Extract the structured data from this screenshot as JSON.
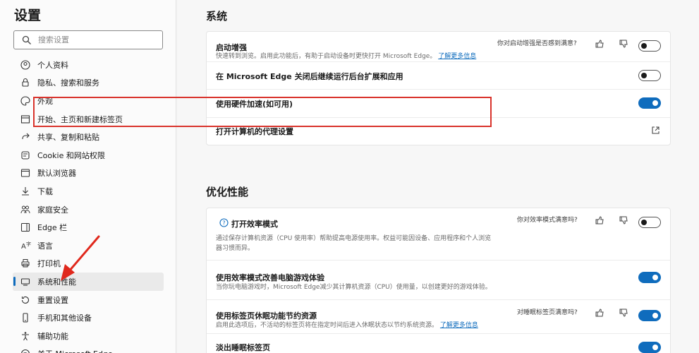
{
  "sidebar": {
    "title": "设置",
    "search_placeholder": "搜索设置",
    "items": [
      {
        "label": "个人资料",
        "icon": "profile-icon"
      },
      {
        "label": "隐私、搜索和服务",
        "icon": "lock-icon"
      },
      {
        "label": "外观",
        "icon": "palette-icon"
      },
      {
        "label": "开始、主页和新建标签页",
        "icon": "home-tab-icon"
      },
      {
        "label": "共享、复制和粘贴",
        "icon": "share-icon"
      },
      {
        "label": "Cookie 和网站权限",
        "icon": "cookie-icon"
      },
      {
        "label": "默认浏览器",
        "icon": "browser-icon"
      },
      {
        "label": "下载",
        "icon": "download-icon"
      },
      {
        "label": "家庭安全",
        "icon": "family-icon"
      },
      {
        "label": "Edge 栏",
        "icon": "edge-bar-icon"
      },
      {
        "label": "语言",
        "icon": "language-icon"
      },
      {
        "label": "打印机",
        "icon": "printer-icon"
      },
      {
        "label": "系统和性能",
        "icon": "system-icon",
        "active": true
      },
      {
        "label": "重置设置",
        "icon": "reset-icon"
      },
      {
        "label": "手机和其他设备",
        "icon": "phone-icon"
      },
      {
        "label": "辅助功能",
        "icon": "accessibility-icon"
      },
      {
        "label": "关于 Microsoft Edge",
        "icon": "edge-icon"
      }
    ]
  },
  "system": {
    "title": "系统",
    "startup_boost": {
      "label": "启动增强",
      "desc": "快速转到浏览。启用此功能后，有助于启动设备时更快打开 Microsoft Edge。",
      "link": "了解更多信息",
      "question": "你对启动增强是否感到满意?",
      "enabled": false
    },
    "background": {
      "label": "在 Microsoft Edge 关闭后继续运行后台扩展和应用",
      "enabled": false
    },
    "hardware": {
      "label": "使用硬件加速(如可用)",
      "enabled": true
    },
    "proxy": {
      "label": "打开计算机的代理设置"
    }
  },
  "performance": {
    "title": "优化性能",
    "efficiency": {
      "label": "打开效率模式",
      "desc1": "通过保存计算机资源（CPU 使用率）帮助提高电源使用率。权益可能因设备、应用程序和个人浏览",
      "desc2": "器习惯而异。",
      "question": "你对效率模式满意吗?",
      "enabled": false
    },
    "gaming": {
      "label": "使用效率模式改善电脑游戏体验",
      "desc": "当你玩电脑游戏时，Microsoft Edge减少其计算机资源（CPU）使用量，以创建更好的游戏体验。",
      "enabled": true
    },
    "sleeping": {
      "label": "使用标签页休眠功能节约资源",
      "desc": "启用此选项后，不活动的标签页将在指定时间后进入休眠状态以节约系统资源。",
      "link": "了解更多信息",
      "question": "对睡眠标签页满意吗?",
      "enabled": true
    },
    "fade": {
      "label": "淡出睡眠标签页",
      "enabled": true
    }
  },
  "colors": {
    "accent": "#0f6cbd",
    "highlight": "#d9332c"
  }
}
